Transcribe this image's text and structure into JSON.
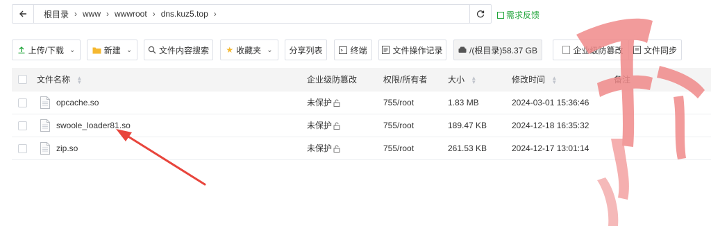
{
  "path_bar": {
    "crumbs": [
      "根目录",
      "www",
      "wwwroot",
      "dns.kuz5.top"
    ],
    "feedback_label": "需求反馈"
  },
  "toolbar": {
    "upload_download": "上传/下载",
    "new": "新建",
    "search_content": "文件内容搜索",
    "favorites": "收藏夹",
    "share_list": "分享列表",
    "terminal": "终端",
    "operation_log": "文件操作记录",
    "disk": "/(根目录)58.37 GB",
    "tamper_proof": "企业级防篡改",
    "file_sync": "文件同步"
  },
  "table": {
    "headers": {
      "name": "文件名称",
      "protection": "企业级防篡改",
      "permission": "权限/所有者",
      "size": "大小",
      "modified": "修改时间",
      "remark": "备注"
    },
    "rows": [
      {
        "name": "opcache.so",
        "protection": "未保护",
        "permission": "755/root",
        "size": "1.83 MB",
        "modified": "2024-03-01 15:36:46"
      },
      {
        "name": "swoole_loader81.so",
        "protection": "未保护",
        "permission": "755/root",
        "size": "189.47 KB",
        "modified": "2024-12-18 16:35:32"
      },
      {
        "name": "zip.so",
        "protection": "未保护",
        "permission": "755/root",
        "size": "261.53 KB",
        "modified": "2024-12-17 13:01:14"
      }
    ]
  },
  "watermark": {
    "romanized_1": "Shou",
    "romanized_2": "Yue"
  },
  "colors": {
    "accent_green": "#20a53a",
    "arrow_red": "#e8453c",
    "watermark_red": "#f08a8a"
  }
}
